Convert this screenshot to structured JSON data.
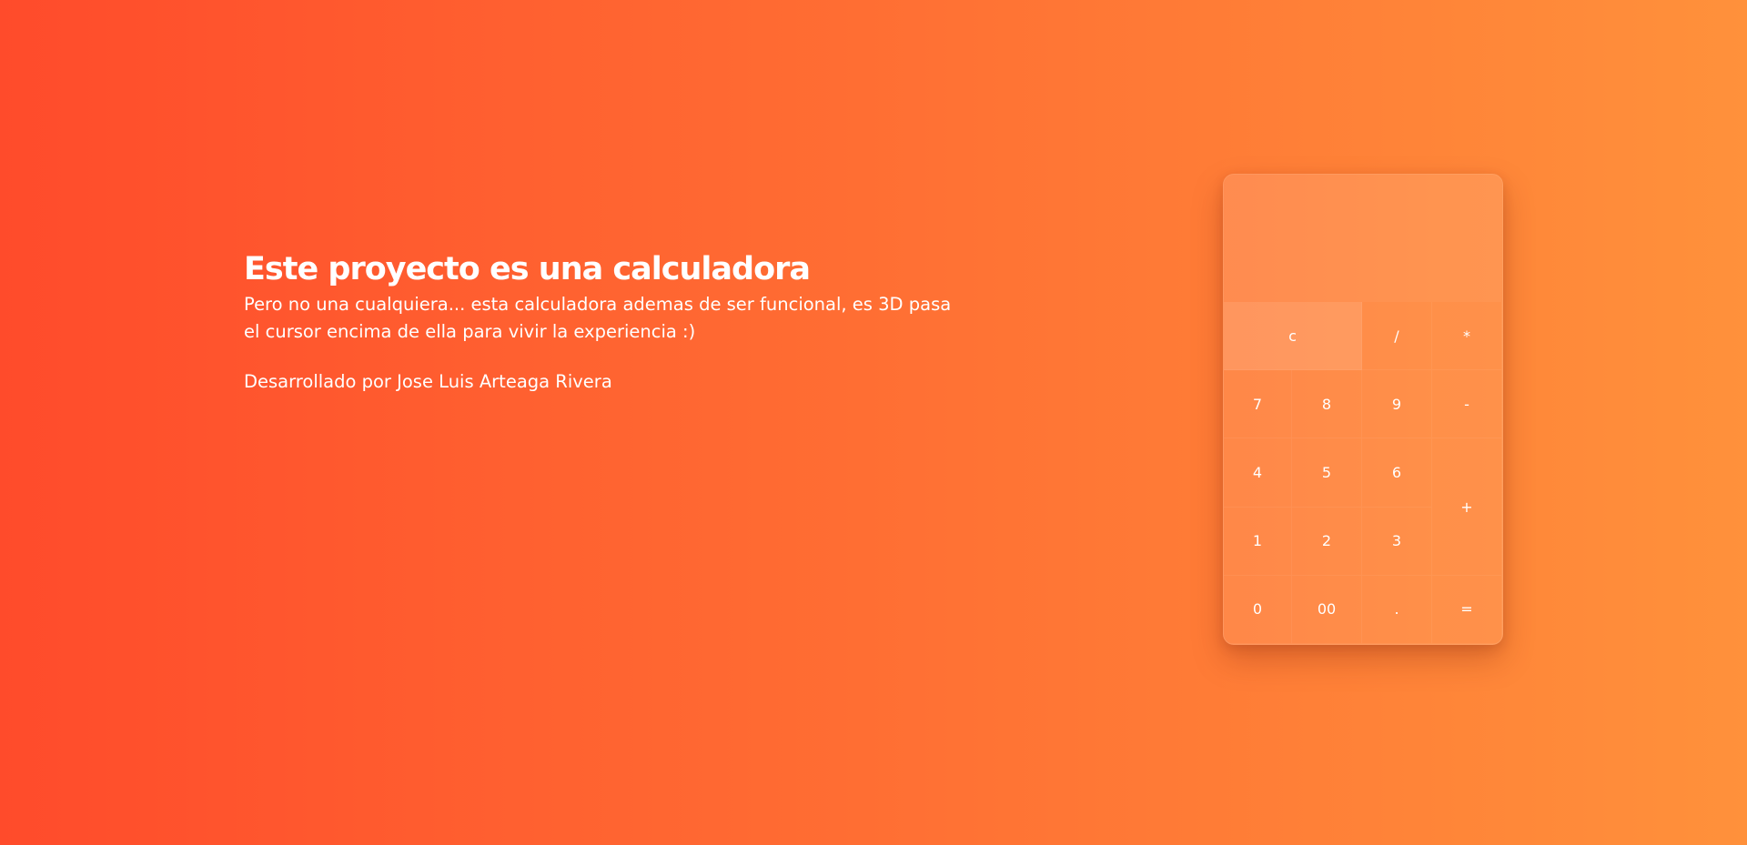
{
  "intro": {
    "title": "Este proyecto es una calculadora",
    "description": "Pero no una cualquiera... esta calculadora ademas de ser funcional, es 3D pasa el cursor encima de ella para vivir la experiencia :)",
    "author": "Desarrollado por Jose Luis Arteaga Rivera"
  },
  "calculator": {
    "display_value": "",
    "keys": {
      "clear": "c",
      "divide": "/",
      "multiply": "*",
      "seven": "7",
      "eight": "8",
      "nine": "9",
      "minus": "-",
      "four": "4",
      "five": "5",
      "six": "6",
      "plus": "+",
      "one": "1",
      "two": "2",
      "three": "3",
      "zero": "0",
      "double_zero": "00",
      "decimal": ".",
      "equals": "="
    }
  },
  "colors": {
    "gradient_start": "#ff4b2b",
    "gradient_end": "#ff913b",
    "text": "#ffffff"
  }
}
